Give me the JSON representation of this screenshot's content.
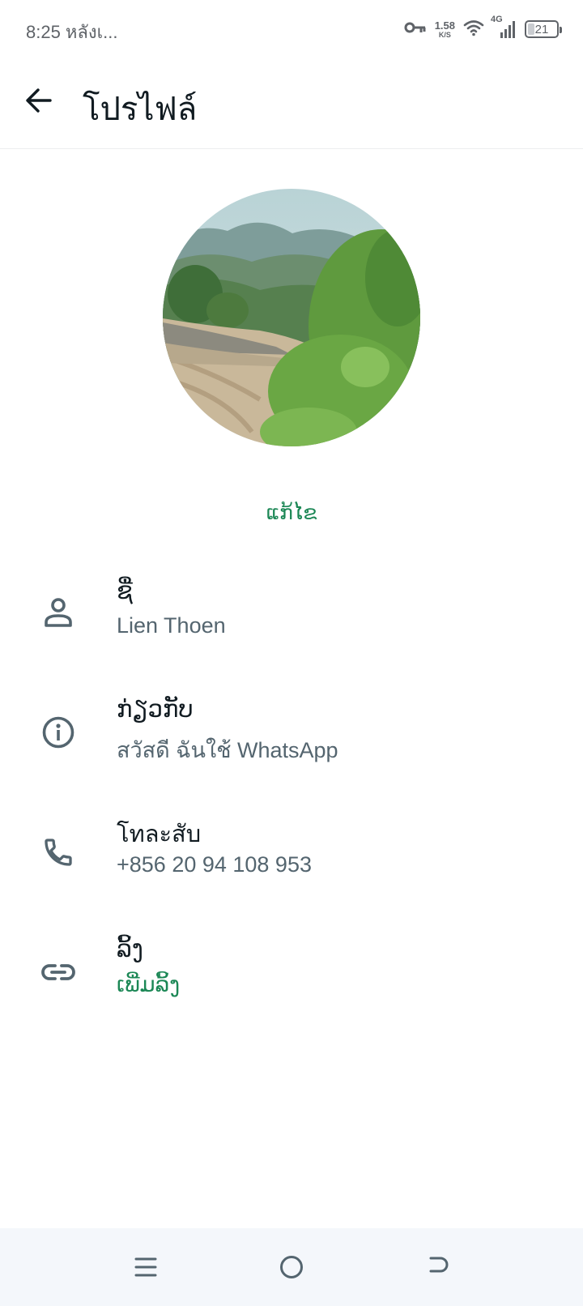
{
  "status_bar": {
    "time_text": "8:25 หลังเ...",
    "net_speed_value": "1.58",
    "net_speed_unit": "K/S",
    "network_type": "4G",
    "battery_level": "21",
    "icons": [
      "vpn-key-icon",
      "wifi-icon",
      "cellular-signal-icon",
      "battery-icon"
    ]
  },
  "header": {
    "title": "โปรไฟล์",
    "back_icon": "arrow-left-icon"
  },
  "profile": {
    "edit_label": "ແກ້ໄຂ"
  },
  "rows": [
    {
      "icon": "person-icon",
      "label": "ຊື່",
      "value": "Lien Thoen"
    },
    {
      "icon": "info-icon",
      "label": "ກ່ຽວກັບ",
      "value": "สวัสดี ฉันใช้ WhatsApp"
    },
    {
      "icon": "phone-icon",
      "label": "โทละสับ",
      "value": "+856 20 94 108 953"
    },
    {
      "icon": "link-icon",
      "label": "ລິ້ງ",
      "value": "ເພີ່ມລິ້ງ"
    }
  ],
  "nav_bar": {
    "icons": [
      "menu-icon",
      "home-circle-icon",
      "back-icon"
    ]
  },
  "colors": {
    "accent_green": "#1b8755",
    "icon_gray": "#54656f",
    "text_primary": "#111b21"
  }
}
